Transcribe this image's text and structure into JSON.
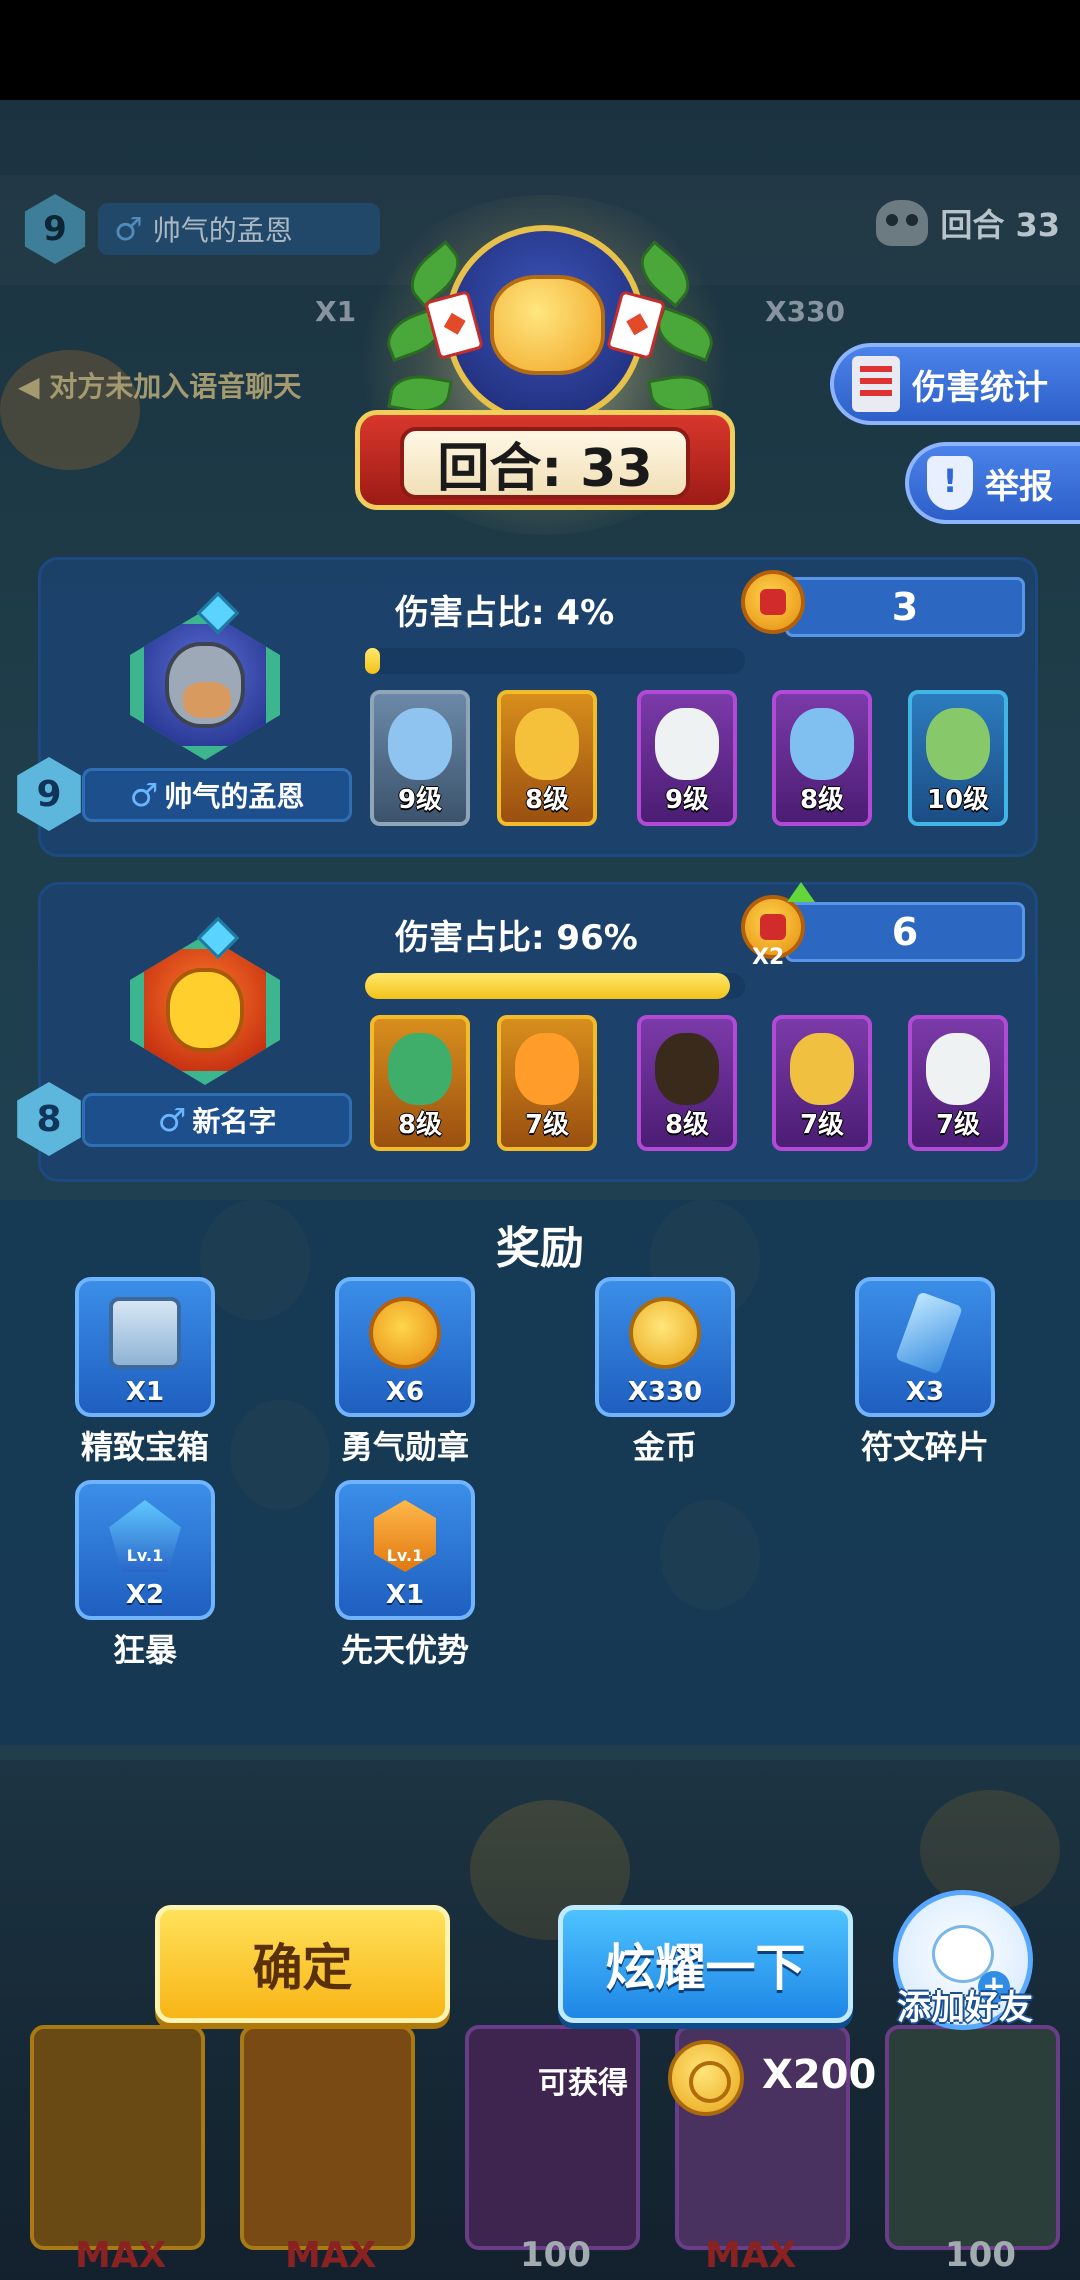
{
  "header": {
    "top_player_level": "9",
    "top_player_name": "帅气的孟恩",
    "round_top_right": "回合 33",
    "voice_note": "对方未加入语音聊天",
    "dim_x_left": "X1",
    "dim_x_right": "X330"
  },
  "emblem": {
    "round_label": "回合: 33"
  },
  "side_buttons": {
    "damage_stats": "伤害统计",
    "report": "举报"
  },
  "players": [
    {
      "level": "9",
      "name": "帅气的孟恩",
      "damage_label": "伤害占比: 4%",
      "damage_fraction": 0.04,
      "medal_count": "3",
      "medal_multiplier": "",
      "heroes": [
        {
          "level": "9级",
          "rarity": "grey",
          "icon": "miner-hero-icon"
        },
        {
          "level": "8级",
          "rarity": "gold",
          "icon": "hooded-lord-hero-icon"
        },
        {
          "level": "9级",
          "rarity": "purple",
          "icon": "mask-hat-hero-icon"
        },
        {
          "level": "8级",
          "rarity": "purple",
          "icon": "warrior-hero-icon"
        },
        {
          "level": "10级",
          "rarity": "blue",
          "icon": "monocle-hero-icon"
        }
      ]
    },
    {
      "level": "8",
      "name": "新名字",
      "damage_label": "伤害占比: 96%",
      "damage_fraction": 0.96,
      "medal_count": "6",
      "medal_multiplier": "X2",
      "heroes": [
        {
          "level": "8级",
          "rarity": "gold",
          "icon": "goblin-hero-icon"
        },
        {
          "level": "7级",
          "rarity": "gold",
          "icon": "fire-hero-icon"
        },
        {
          "level": "8级",
          "rarity": "purple",
          "icon": "jawa-hero-icon"
        },
        {
          "level": "7级",
          "rarity": "purple",
          "icon": "astronaut-hero-icon"
        },
        {
          "level": "7级",
          "rarity": "purple",
          "icon": "mask-hat-hero-icon"
        }
      ]
    }
  ],
  "rewards": {
    "title": "奖励",
    "items": [
      {
        "name": "精致宝箱",
        "qty": "X1",
        "icon": "chest-icon"
      },
      {
        "name": "勇气勋章",
        "qty": "X6",
        "icon": "courage-medal-icon"
      },
      {
        "name": "金币",
        "qty": "X330",
        "icon": "gold-coin-icon"
      },
      {
        "name": "符文碎片",
        "qty": "X3",
        "icon": "rune-shard-icon"
      },
      {
        "name": "狂暴",
        "qty": "X2",
        "icon": "rage-icon",
        "badge": "Lv.1"
      },
      {
        "name": "先天优势",
        "qty": "X1",
        "icon": "innate-advantage-icon",
        "badge": "Lv.1"
      }
    ]
  },
  "bottom": {
    "confirm_label": "确定",
    "show_off_label": "炫耀一下",
    "add_friend_label": "添加好友",
    "obtain_label": "可获得",
    "obtain_qty": "X200",
    "max_1": "MAX",
    "max_2": "MAX",
    "max_3": "MAX",
    "cost_1": "100",
    "cost_2": "100"
  }
}
